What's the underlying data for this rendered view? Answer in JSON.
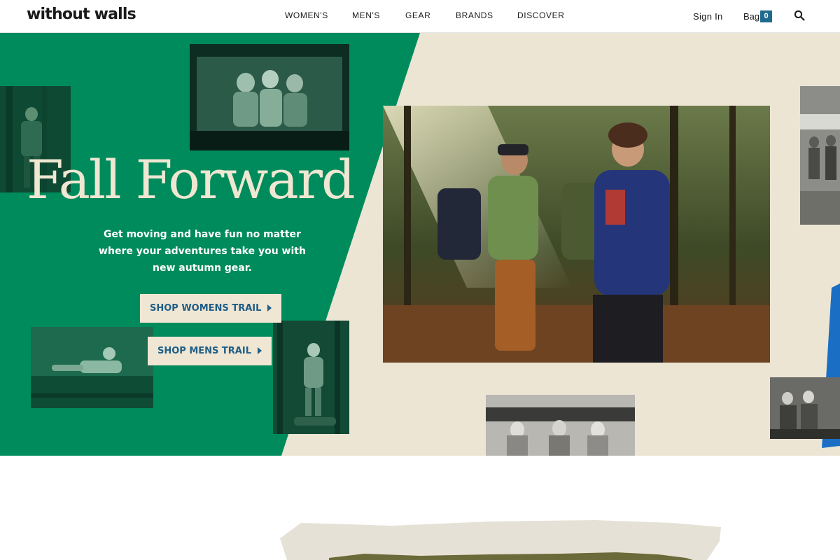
{
  "brand": {
    "logo_text": "without walls"
  },
  "nav": {
    "items": [
      {
        "label": "WOMEN'S"
      },
      {
        "label": "MEN'S"
      },
      {
        "label": "GEAR"
      },
      {
        "label": "BRANDS"
      },
      {
        "label": "DISCOVER"
      }
    ]
  },
  "account": {
    "sign_in_label": "Sign In",
    "bag_label": "Bag",
    "bag_count": "0"
  },
  "hero": {
    "headline": "Fall Forward",
    "subtext": "Get moving and have fun no matter where your adventures take you with new autumn gear.",
    "cta_womens": "SHOP WOMENS TRAIL",
    "cta_mens": "SHOP MENS TRAIL"
  },
  "colors": {
    "green": "#008b5c",
    "cream": "#ece5d4",
    "link_blue": "#1f5d85",
    "bag_badge": "#1f6b8f",
    "accent_blue": "#1a6fc4"
  },
  "icons": {
    "search": "search-icon",
    "cta_arrow": "triangle-right-icon"
  }
}
